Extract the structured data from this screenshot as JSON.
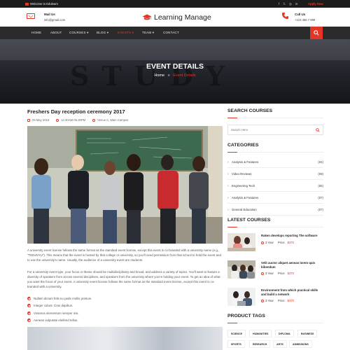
{
  "topbar": {
    "welcome": "Welcome to Edulearn",
    "social_icons": [
      "facebook-icon",
      "twitter-icon",
      "instagram-icon",
      "linkedin-icon"
    ],
    "apply_now": "Apply Now"
  },
  "header": {
    "mail_label": "Mail Us",
    "mail_value": "info@gmail.com",
    "logo_text": "Learning Manage",
    "call_label": "Call Us",
    "call_value": "+123 456 7 890"
  },
  "nav": {
    "items": [
      {
        "label": "HOME",
        "has_dropdown": false
      },
      {
        "label": "ABOUT",
        "has_dropdown": false
      },
      {
        "label": "COURSES ▾",
        "has_dropdown": true
      },
      {
        "label": "BLOG ▾",
        "has_dropdown": true
      },
      {
        "label": "EVENTS ▾",
        "has_dropdown": true
      },
      {
        "label": "TEAM ▾",
        "has_dropdown": true
      },
      {
        "label": "CONTACT",
        "has_dropdown": false
      }
    ],
    "active_index": 4
  },
  "banner": {
    "bg_word": "STUDY",
    "title": "EVENT DETAILS",
    "crumb_home": "Home",
    "crumb_sep": "»",
    "crumb_current": "Event Details"
  },
  "event": {
    "title": "Freshers Day reception ceremony 2017",
    "date": "29 May 2019",
    "time": "12.30AM-05.30PM",
    "venue": "Venue C, Main Campus",
    "paragraphs": [
      "A university event license follows the same format as the standard event license, except this event is co-branded with a university name (e.g., \"TEDxNYU\"). This means that the event is hosted by that college or university, so you'll need permission from that school to hold the event and to use the university's name. Usually, the audience of a university event are students.",
      "For a university event type, your focus or theme should be multidisciplinary and broad, and address a variety of topics. You'll want to feature a diversity of speakers from across several disciplines, and speakers from the university where you're holding your event. To get an idea of what you want the focus of your event. A university event license follows the same format as the standard event license, except this event is co-branded with a university."
    ],
    "bullets": [
      "Nullam dictum felis eu pede mollis pretium.",
      "Integer cidunt. Cras dapibus.",
      "Vivamus elementum semper nisi.",
      "Aenean vulputate eleifend tellus."
    ]
  },
  "sidebar": {
    "search_heading": "SEARCH COURSES",
    "search_placeholder": "Search Here",
    "categories_heading": "CATEGORIES",
    "categories": [
      {
        "label": "Analysis & Features",
        "count": "(04)"
      },
      {
        "label": "Video Reviews",
        "count": "(09)"
      },
      {
        "label": "Engineering Tech",
        "count": "(05)"
      },
      {
        "label": "Analysis & Features",
        "count": "(07)"
      },
      {
        "label": "General Education",
        "count": "(07)"
      }
    ],
    "latest_heading": "LATEST COURSES",
    "courses": [
      {
        "title": "Raken develops reporting The software",
        "duration": "3 Year",
        "price_label": "Price:",
        "price": "$370"
      },
      {
        "title": "Velit auctor aliquet aenean lorem quis bibendum",
        "duration": "3 Year",
        "price_label": "Price:",
        "price": "$370"
      },
      {
        "title": "Environment from which practical skills and build a network",
        "duration": "3 Year",
        "price_label": "Price:",
        "price": "$370"
      }
    ],
    "tags_heading": "PRODUCT TAGS",
    "tags": [
      "SCIENCE",
      "HUMANITIES",
      "DIPLOMA",
      "BUSINESS",
      "SPORTS",
      "RESEARCH",
      "ARTS",
      "ADMISSIONS"
    ]
  },
  "colors": {
    "accent": "#e63524",
    "nav_bg": "#2b2b2b",
    "topbar_bg": "#1b1b1b"
  }
}
